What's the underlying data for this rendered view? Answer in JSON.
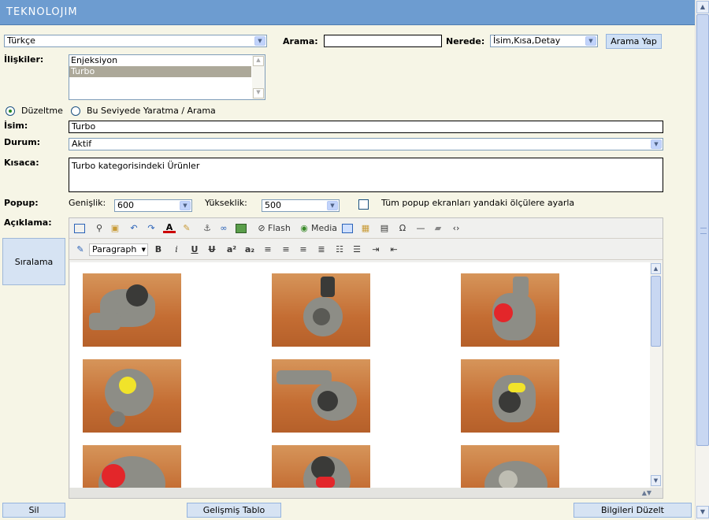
{
  "header": {
    "logo": "TEKNOLOJIM"
  },
  "language_select": {
    "value": "Türkçe"
  },
  "search": {
    "label": "Arama:",
    "value": "",
    "where_label": "Nerede:",
    "where_value": "İsim,Kısa,Detay",
    "button": "Arama Yap"
  },
  "relations": {
    "label": "İlişkiler:",
    "items": [
      "Enjeksiyon",
      "Turbo"
    ],
    "selected": "Turbo"
  },
  "mode": {
    "edit_label": "Düzeltme",
    "create_label": "Bu Seviyede Yaratma / Arama",
    "selected": "edit"
  },
  "fields": {
    "name_label": "İsim:",
    "name_value": "Turbo",
    "status_label": "Durum:",
    "status_value": "Aktif",
    "short_label": "Kısaca:",
    "short_value": "Turbo kategorisindeki Ürünler"
  },
  "popup": {
    "label": "Popup:",
    "width_label": "Genişlik:",
    "width_value": "600",
    "height_label": "Yükseklik:",
    "height_value": "500",
    "all_label": "Tüm popup ekranları yandaki ölçülere ayarla",
    "all_checked": false
  },
  "description": {
    "label": "Açıklama:"
  },
  "side": {
    "sort_button": "Sıralama"
  },
  "editor": {
    "toolbar1": {
      "flash": "Flash",
      "media": "Media"
    },
    "toolbar2": {
      "format": "Paragraph"
    },
    "images": [
      "turbo-1",
      "turbo-2",
      "turbo-3",
      "turbo-4",
      "turbo-5",
      "turbo-6",
      "turbo-7",
      "turbo-8",
      "turbo-9"
    ]
  },
  "footer": {
    "delete": "Sil",
    "advanced_table": "Gelişmiş Tablo",
    "update": "Bilgileri Düzelt"
  },
  "colors": {
    "header": "#6d9cd0",
    "page_bg": "#f6f5e6",
    "button_bg": "#cfe0f5"
  }
}
